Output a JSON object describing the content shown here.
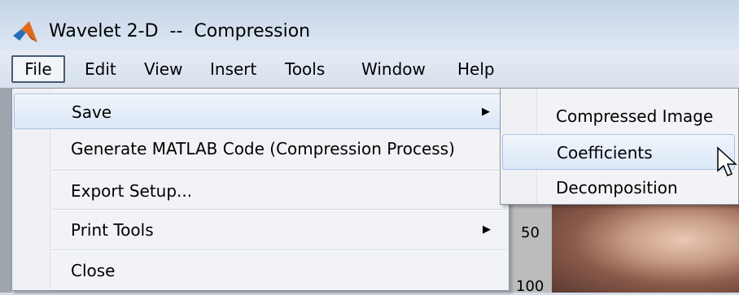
{
  "window": {
    "title": "Wavelet 2-D  --  Compression"
  },
  "menubar": {
    "items": [
      "File",
      "Edit",
      "View",
      "Insert",
      "Tools",
      "Window",
      "Help"
    ]
  },
  "file_menu": {
    "save": "Save",
    "generate": "Generate MATLAB Code (Compression Process)",
    "export": "Export Setup...",
    "print_tools": "Print Tools",
    "close": "Close",
    "arrow": "▶"
  },
  "save_submenu": {
    "compressed_image": "Compressed Image",
    "coefficients": "Coefficients",
    "decomposition": "Decomposition"
  },
  "axis": {
    "tick_50": "50",
    "tick_100": "100"
  },
  "colors": {
    "selection": "#dbe7f7",
    "menu_bg": "#f2f3f6",
    "accent": "#455a76"
  }
}
